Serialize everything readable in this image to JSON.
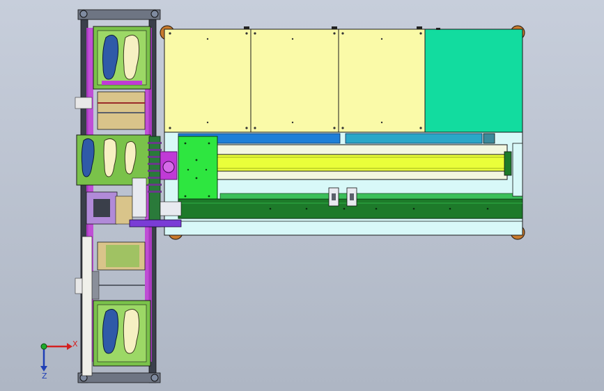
{
  "viewport": {
    "background_top": "#c7cedb",
    "background_bottom": "#aeb6c4"
  },
  "colors": {
    "yellow_panel": "#fafaa8",
    "teal_panel": "#12dc9f",
    "rail_blue": "#1e7fd8",
    "rail_cyan": "#2aa7c8",
    "light_cyan": "#d8f8f8",
    "frame_green": "#7ac24a",
    "bright_green": "#2ee640",
    "dark_green": "#1d7a2a",
    "yellow_green": "#eaff3a",
    "magenta": "#c03ad6",
    "purple": "#7a3cd6",
    "shoe_blue": "#2f5aa8",
    "shoe_cream": "#f6f0c2",
    "beige": "#d9c48a",
    "caster_orange": "#c87a2c",
    "dark_frame": "#2a2a2a"
  },
  "triad": {
    "x_label": "X",
    "z_label": "Z",
    "x_color": "#d32020",
    "y_color": "#1faa2a",
    "z_color": "#1f3fb5",
    "x_icon": "axis-x-arrow-icon",
    "z_icon": "axis-z-arrow-icon"
  }
}
